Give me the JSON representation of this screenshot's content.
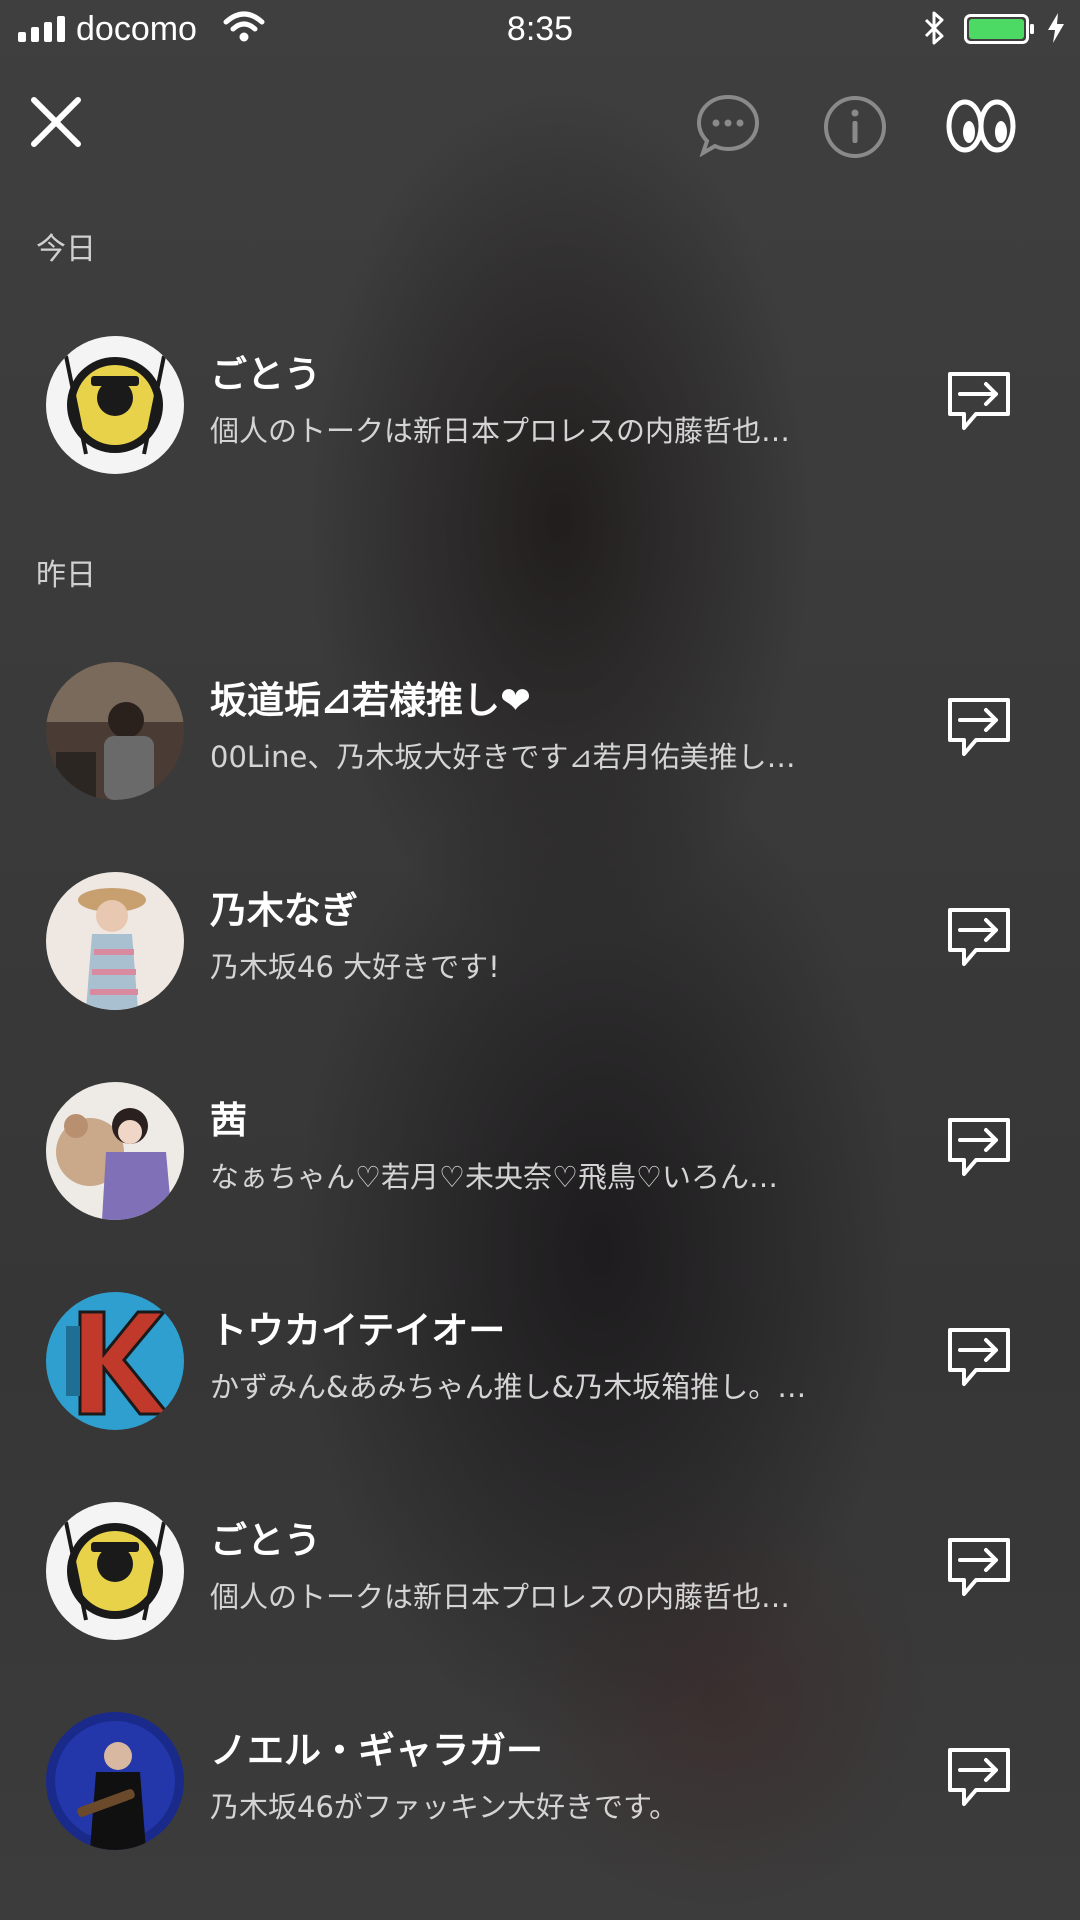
{
  "status_bar": {
    "carrier": "docomo",
    "time": "8:35"
  },
  "header": {
    "close_icon": "close-icon",
    "chat_icon": "chat-bubble-dots-icon",
    "info_icon": "info-icon",
    "eyes_icon": "eyes-icon"
  },
  "sections": [
    {
      "label": "今日"
    },
    {
      "label": "昨日"
    }
  ],
  "rows": [
    {
      "name": "ごとう",
      "message": "個人のトークは新日本プロレスの内藤哲也…",
      "avatar_color": "#e8d24a"
    },
    {
      "name": "坂道垢⊿若様推し❤",
      "message": "00Line、乃木坂大好きです⊿若月佑美推し…",
      "avatar_color": "#5a4a40"
    },
    {
      "name": "乃木なぎ",
      "message": "乃木坂46  大好きです!",
      "avatar_color": "#e6d8cc"
    },
    {
      "name": "茜",
      "message": "なぁちゃん♡若月♡未央奈♡飛鳥♡いろん…",
      "avatar_color": "#c9a98a"
    },
    {
      "name": "トウカイテイオー",
      "message": "かずみん&あみちゃん推し&乃木坂箱推し。…",
      "avatar_color": "#2f9fd0"
    },
    {
      "name": "ごとう",
      "message": "個人のトークは新日本プロレスの内藤哲也…",
      "avatar_color": "#e8d24a"
    },
    {
      "name": "ノエル・ギャラガー",
      "message": "乃木坂46がファッキン大好きです。",
      "avatar_color": "#1a2a8a"
    }
  ],
  "colors": {
    "background": "#3a3a3a",
    "battery": "#4cd964",
    "icon_gray": "#8a8a8a",
    "text_secondary": "#d4d4d4"
  }
}
